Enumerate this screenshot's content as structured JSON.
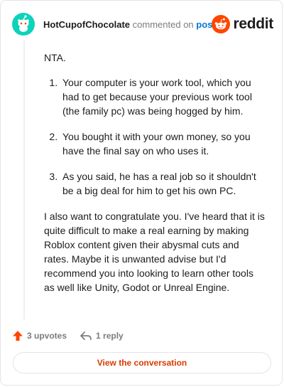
{
  "comment": {
    "author": "HotCupofChocolate",
    "commented_on_text": "commented on",
    "post_link_text": "post",
    "intro": "NTA.",
    "points": [
      "Your computer is your work tool, which you had to get because your previous work tool (the family pc) was being hogged by him.",
      "You bought it with your own money, so you have the final say on who uses it.",
      "As you said, he has a real job so it shouldn't be a big deal for him to get his own PC."
    ],
    "closing": "I also want to congratulate you. I've heard that it is quite difficult to make a real earning by making Roblox content given their abysmal cuts and rates. Maybe it is unwanted advise but I'd recommend you into looking to learn other tools as well like Unity, Godot or Unreal Engine."
  },
  "brand": {
    "logo_text": "reddit",
    "accent_color": "#ff4500"
  },
  "actions": {
    "upvotes_label": "3 upvotes",
    "reply_label": "1 reply",
    "view_conversation_label": "View the conversation"
  },
  "icons": {
    "avatar": "snoo-avatar-icon",
    "logo": "reddit-logo-icon",
    "upvote": "upvote-arrow-icon",
    "reply": "reply-arrow-icon"
  }
}
